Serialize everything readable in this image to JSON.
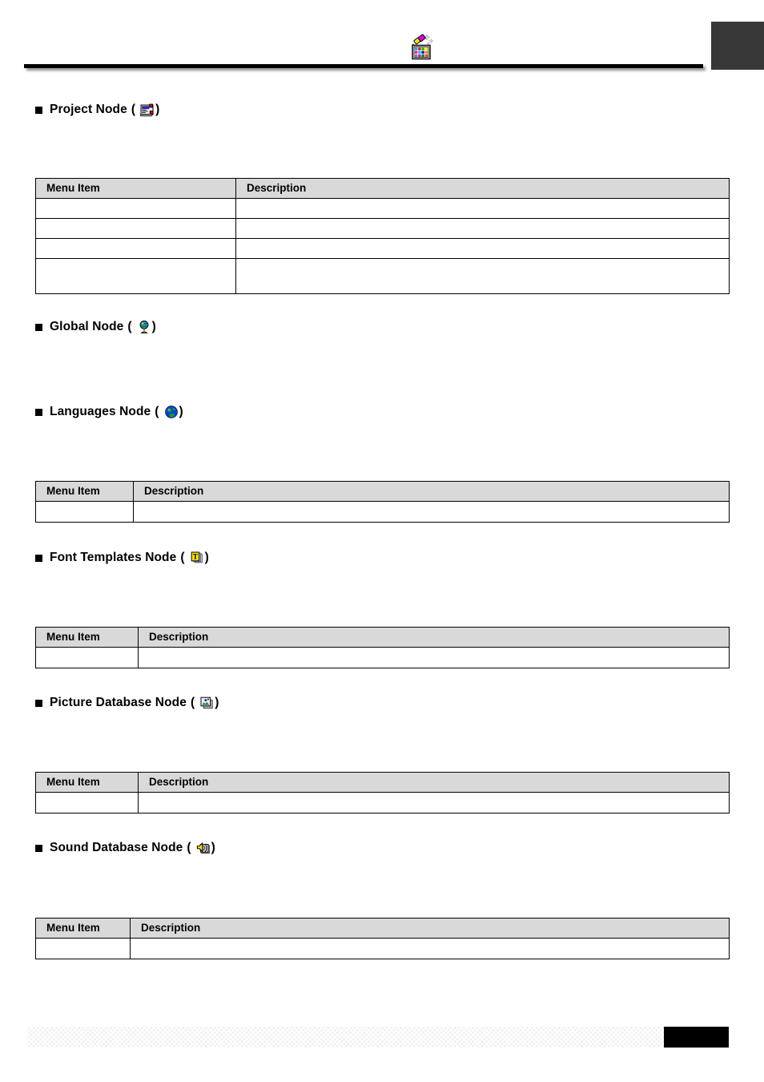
{
  "header": {
    "logo_icon": "picture-database-paint-icon",
    "corner_box_color": "#383838",
    "rule_color": "#000000"
  },
  "table_headers": {
    "menu_item": "Menu Item",
    "description": "Description"
  },
  "sections": [
    {
      "id": "project-node",
      "bullet": "■",
      "label": "Project Node",
      "paren_open": "(",
      "paren_close": ")",
      "icon": "project-node-icon",
      "table": {
        "columns": [
          "Menu Item",
          "Description"
        ],
        "rows": [
          {
            "menu_item": "",
            "description": ""
          },
          {
            "menu_item": "",
            "description": ""
          },
          {
            "menu_item": "",
            "description": ""
          },
          {
            "menu_item": "",
            "description": ""
          }
        ]
      }
    },
    {
      "id": "global-node",
      "bullet": "■",
      "label": "Global Node",
      "paren_open": "(",
      "paren_close": ")",
      "icon": "globe-stand-icon",
      "table": null
    },
    {
      "id": "languages-node",
      "bullet": "■",
      "label": "Languages Node",
      "paren_open": "(",
      "paren_close": ")",
      "icon": "earth-globe-icon",
      "table": {
        "columns": [
          "Menu Item",
          "Description"
        ],
        "rows": [
          {
            "menu_item": "",
            "description": ""
          }
        ]
      }
    },
    {
      "id": "font-templates-node",
      "bullet": "■",
      "label": "Font Templates Node",
      "paren_open": "(",
      "paren_close": ")",
      "icon": "font-template-t-icon",
      "table": {
        "columns": [
          "Menu Item",
          "Description"
        ],
        "rows": [
          {
            "menu_item": "",
            "description": ""
          }
        ]
      }
    },
    {
      "id": "picture-database-node",
      "bullet": "■",
      "label": "Picture Database Node",
      "paren_open": "(",
      "paren_close": ")",
      "icon": "picture-stack-icon",
      "table": {
        "columns": [
          "Menu Item",
          "Description"
        ],
        "rows": [
          {
            "menu_item": "",
            "description": ""
          }
        ]
      }
    },
    {
      "id": "sound-database-node",
      "bullet": "■",
      "label": "Sound Database Node",
      "paren_open": "(",
      "paren_close": ")",
      "icon": "sound-speaker-icon",
      "table": {
        "columns": [
          "Menu Item",
          "Description"
        ],
        "rows": [
          {
            "menu_item": "",
            "description": ""
          }
        ]
      }
    }
  ],
  "footer": {
    "bar_color": "#ededed",
    "page_box_color": "#000000",
    "page_number": ""
  }
}
